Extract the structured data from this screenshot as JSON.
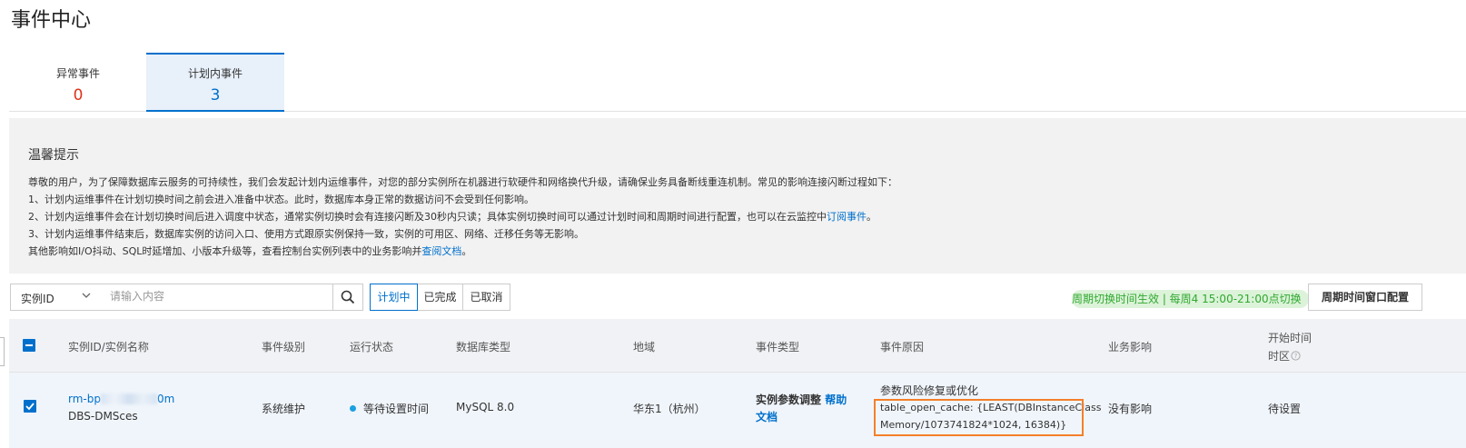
{
  "page_title": "事件中心",
  "tabs": [
    {
      "label": "异常事件",
      "count": "0"
    },
    {
      "label": "计划内事件",
      "count": "3"
    }
  ],
  "tips": {
    "title": "温馨提示",
    "line1": "尊敬的用户，为了保障数据库云服务的可持续性，我们会发起计划内运维事件，对您的部分实例所在机器进行软硬件和网络换代升级，请确保业务具备断线重连机制。常见的影响连接闪断过程如下：",
    "line2": "1、计划内运维事件在计划切换时间之前会进入准备中状态。此时，数据库本身正常的数据访问不会受到任何影响。",
    "line3_pre": "2、计划内运维事件会在计划切换时间后进入调度中状态，通常实例切换时会有连接闪断及30秒内只读；具体实例切换时间可以通过计划时间和周期时间进行配置，也可以在云监控中",
    "line3_link": "订阅事件",
    "line3_post": "。",
    "line4": "3、计划内运维事件结束后，数据库实例的访问入口、使用方式跟原实例保持一致，实例的可用区、网络、迁移任务等无影响。",
    "line5_pre": "其他影响如I/O抖动、SQL时延增加、小版本升级等，查看控制台实例列表中的业务影响并",
    "line5_link": "查阅文档",
    "line5_post": "。"
  },
  "filter": {
    "select_value": "实例ID",
    "search_placeholder": "请输入内容",
    "status_buttons": [
      "计划中",
      "已完成",
      "已取消"
    ]
  },
  "notice": "周期切换时间生效 | 每周4 15:00-21:00点切换",
  "config_button": "周期时间窗口配置",
  "table": {
    "headers": {
      "instance": "实例ID/实例名称",
      "level": "事件级别",
      "status": "运行状态",
      "db_type": "数据库类型",
      "region": "地域",
      "event_type": "事件类型",
      "reason": "事件原因",
      "impact": "业务影响",
      "start_time": "开始时间",
      "timezone": "时区"
    },
    "rows": [
      {
        "instance_id_prefix": "rm-bp",
        "instance_id_suffix": "0m",
        "instance_name": "DBS-DMSces",
        "level": "系统维护",
        "status": "等待设置时间",
        "db_type": "MySQL 8.0",
        "region": "华东1（杭州）",
        "event_type": "实例参数调整",
        "help_link_1": "帮助",
        "help_link_2": "文档",
        "reason_title": "参数风险修复或优化",
        "reason_line1": "table_open_cache: {LEAST(DBInstanceClass",
        "reason_line2": "Memory/1073741824*1024, 16384)}",
        "impact": "没有影响",
        "start_time": "待设置"
      }
    ]
  },
  "colors": {
    "accent": "#0070cc",
    "error": "#e0321b",
    "success": "#31a831",
    "highlight_box": "#f47f2b"
  }
}
